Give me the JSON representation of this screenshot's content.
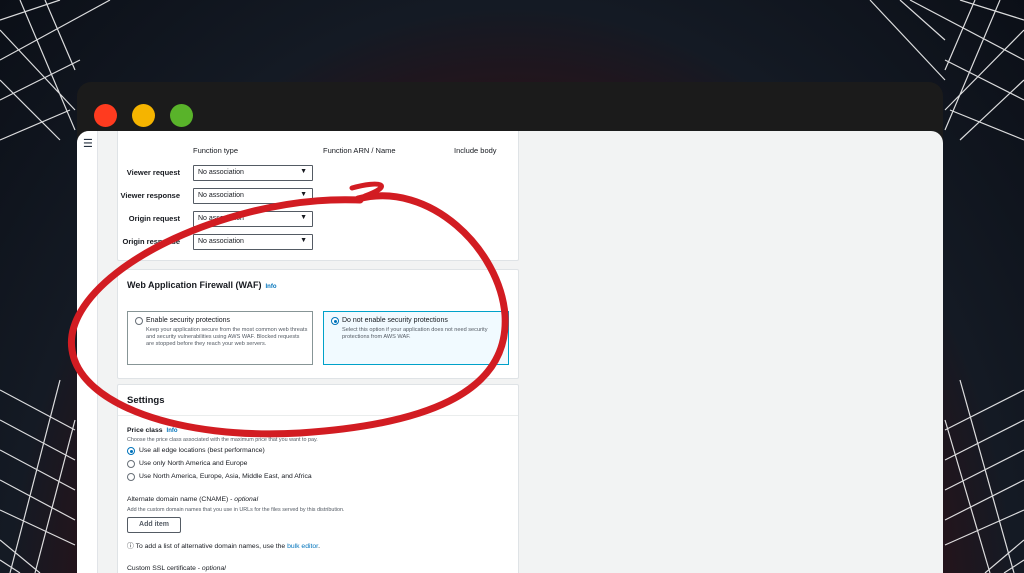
{
  "colors": {
    "accent": "#0073bb",
    "annotation": "#d21c22",
    "close": "#ff3b1f",
    "minimize": "#f5b400",
    "maximize": "#59b32a"
  },
  "functions": {
    "headers": [
      "Function type",
      "Function ARN / Name",
      "Include body"
    ],
    "rows": [
      {
        "label": "Viewer request",
        "value": "No association"
      },
      {
        "label": "Viewer response",
        "value": "No association"
      },
      {
        "label": "Origin request",
        "value": "No association"
      },
      {
        "label": "Origin response",
        "value": "No association"
      }
    ]
  },
  "waf": {
    "title": "Web Application Firewall (WAF)",
    "info": "Info",
    "options": [
      {
        "title": "Enable security protections",
        "description": "Keep your application secure from the most common web threats and security vulnerabilities using AWS WAF. Blocked requests are stopped before they reach your web servers.",
        "selected": false
      },
      {
        "title": "Do not enable security protections",
        "description": "Select this option if your application does not need security protections from AWS WAF.",
        "selected": true
      }
    ]
  },
  "settings": {
    "title": "Settings",
    "price_class_label": "Price class",
    "price_class_info": "Info",
    "price_class_hint": "Choose the price class associated with the maximum price that you want to pay.",
    "price_options": [
      {
        "label": "Use all edge locations (best performance)",
        "selected": true
      },
      {
        "label": "Use only North America and Europe",
        "selected": false
      },
      {
        "label": "Use North America, Europe, Asia, Middle East, and Africa",
        "selected": false
      }
    ],
    "cname_label": "Alternate domain name (CNAME) -",
    "cname_optional": "optional",
    "cname_hint": "Add the custom domain names that you use in URLs for the files served by this distribution.",
    "add_item": "Add item",
    "bulk_text": "To add a list of alternative domain names, use the",
    "bulk_link": "bulk editor",
    "bulk_end": ".",
    "ssl_label": "Custom SSL certificate -",
    "ssl_optional": "optional"
  }
}
